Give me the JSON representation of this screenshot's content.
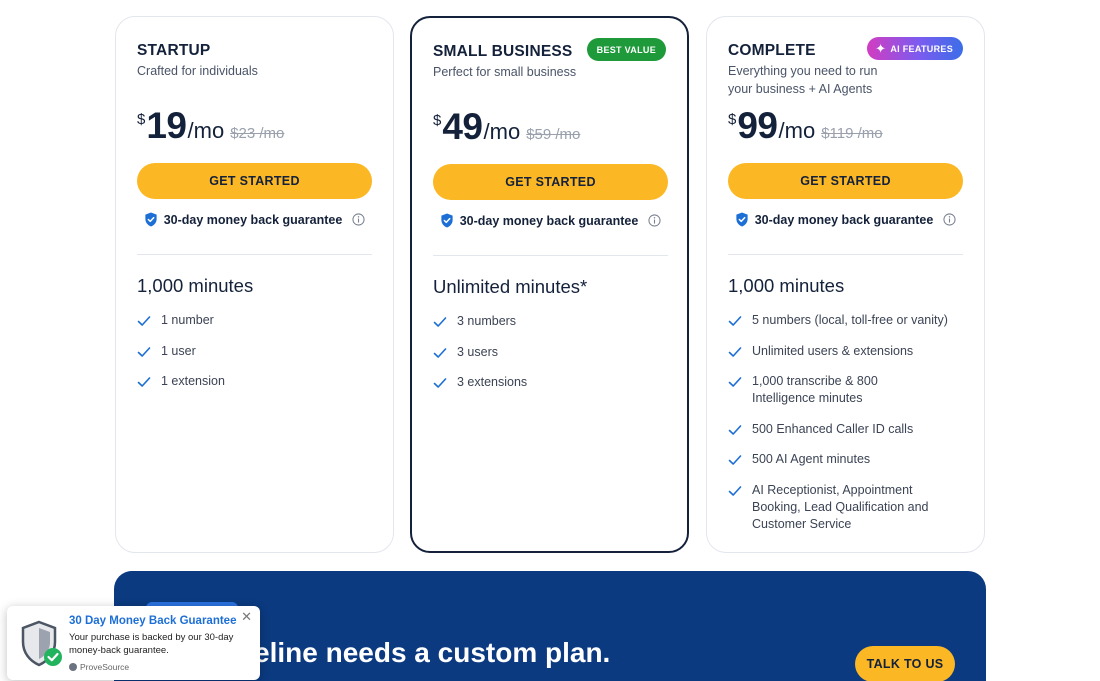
{
  "plans": [
    {
      "name": "STARTUP",
      "subtitle": "Crafted for individuals",
      "currency": "$",
      "price": "19",
      "period": "/mo",
      "old_price": "$23 /mo",
      "cta": "GET STARTED",
      "guarantee": "30-day money back guarantee",
      "minutes": "1,000 minutes",
      "features": [
        "1 number",
        "1 user",
        "1 extension"
      ]
    },
    {
      "name": "SMALL BUSINESS",
      "subtitle": "Perfect for small business",
      "badge": "BEST VALUE",
      "currency": "$",
      "price": "49",
      "period": "/mo",
      "old_price": "$59 /mo",
      "cta": "GET STARTED",
      "guarantee": "30-day money back guarantee",
      "minutes": "Unlimited minutes*",
      "features": [
        "3 numbers",
        "3 users",
        "3 extensions"
      ]
    },
    {
      "name": "COMPLETE",
      "subtitle": "Everything you need to run your business + AI Agents",
      "badge": "AI FEATURES",
      "currency": "$",
      "price": "99",
      "period": "/mo",
      "old_price": "$119 /mo",
      "cta": "GET STARTED",
      "guarantee": "30-day money back guarantee",
      "minutes": "1,000 minutes",
      "features": [
        "5 numbers (local, toll-free or vanity)",
        "Unlimited users & extensions",
        "1,000 transcribe & 800 Intelligence minutes",
        "500 Enhanced Caller ID calls",
        "500 AI Agent minutes",
        "AI Receptionist, Appointment Booking, Lead Qualification and Customer Service"
      ]
    }
  ],
  "banner": {
    "text": "eline needs a custom plan.",
    "cta": "TALK TO US"
  },
  "toast": {
    "title": "30 Day Money Back Guarantee",
    "body": "Your purchase is backed by our 30-day money-back guarantee.",
    "source": "ProveSource",
    "close": "✕"
  },
  "colors": {
    "accent_yellow": "#fbb724",
    "navy": "#0b3a80",
    "text_dark": "#14213a",
    "check_blue": "#1d6fd6",
    "badge_green": "#1f9a3a"
  }
}
